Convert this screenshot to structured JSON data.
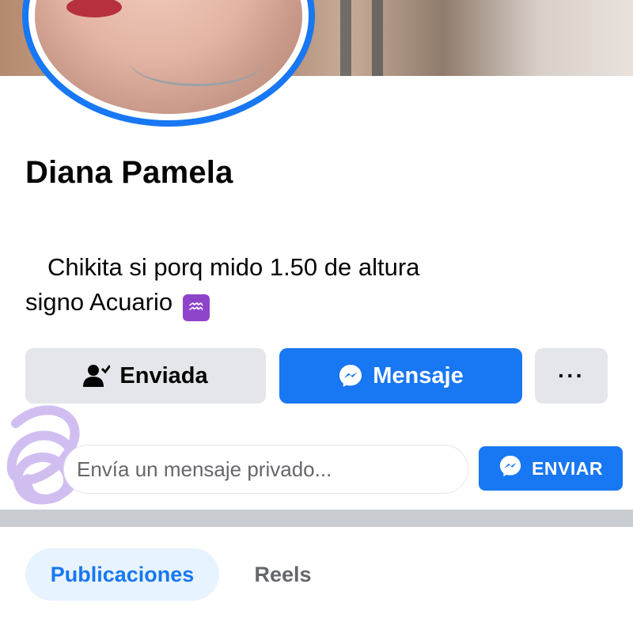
{
  "profile": {
    "name": "Diana Pamela",
    "bio_line1": "Chikita si porq mido 1.50 de altura",
    "bio_line2": "signo Acuario",
    "bio_emoji": "♒"
  },
  "actions": {
    "friend_request_label": "Enviada",
    "message_label": "Mensaje",
    "more_label": "···"
  },
  "private_message": {
    "placeholder": "Envía un mensaje privado...",
    "send_label": "ENVIAR"
  },
  "tabs": [
    {
      "label": "Publicaciones",
      "active": true
    },
    {
      "label": "Reels",
      "active": false
    }
  ],
  "icons": {
    "friend_request": "person-check-icon",
    "messenger": "messenger-icon",
    "more": "more-dots-icon"
  },
  "colors": {
    "accent": "#1877f2",
    "button_gray": "#e4e6eb",
    "active_tab_bg": "#e7f3ff",
    "text": "#050505",
    "muted_text": "#65676b"
  }
}
